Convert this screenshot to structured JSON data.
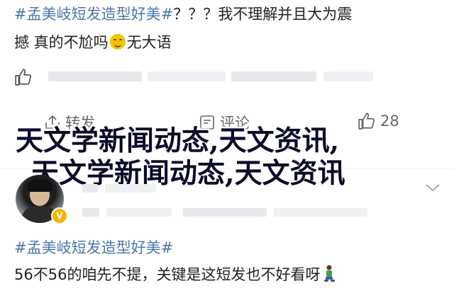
{
  "post1": {
    "hashtag": "#孟美岐短发造型好美#",
    "text_line1_rest": "？？？我不理解并且大为震",
    "text_line2_a": "撼 真的不尬吗",
    "text_line2_b": "无大语",
    "emoji_icon": "grin-sweat-emoji-icon"
  },
  "actions": {
    "repost_label": "转发",
    "comment_label": "评论",
    "like_count": "28"
  },
  "overlay": {
    "line1": "天文学新闻动态,天文资讯,",
    "line2": "天文学新闻动态,天文资讯"
  },
  "post2": {
    "hashtag": "#孟美岐短发造型好美#",
    "text": "56不56的咱先不提，关键是这短发也不好看呀",
    "emoji_icon": "kneeling-person-emoji-icon",
    "verified_icon": "verified-badge-icon"
  },
  "colors": {
    "hashtag": "#4b76b0",
    "text": "#222222",
    "muted": "#666666",
    "badge": "#f7b500"
  }
}
